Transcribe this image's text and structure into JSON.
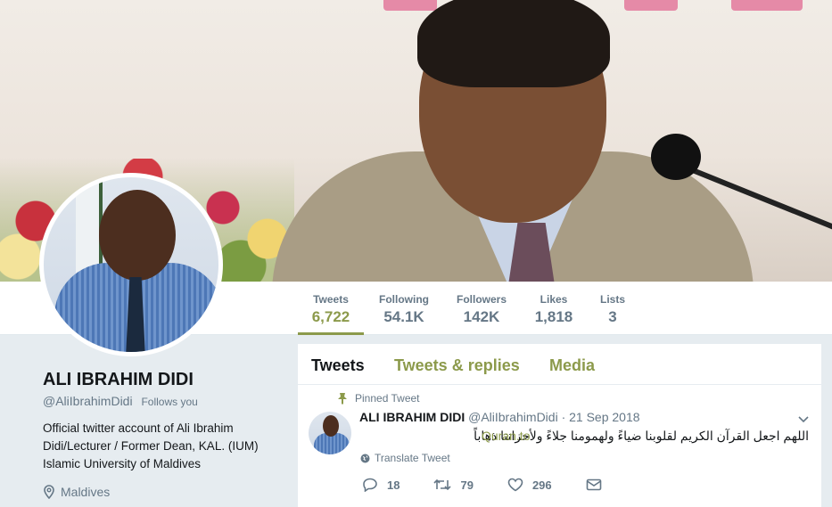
{
  "profile": {
    "name": "ALI IBRAHIM DIDI",
    "handle": "@AliIbrahimDidi",
    "follows_you": "Follows you",
    "bio": "Official twitter account of Ali Ibrahim Didi/Lecturer / Former Dean, KAL. (IUM) Islamic University of Maldives",
    "location": "Maldives"
  },
  "stats": [
    {
      "label": "Tweets",
      "value": "6,722"
    },
    {
      "label": "Following",
      "value": "54.1K"
    },
    {
      "label": "Followers",
      "value": "142K"
    },
    {
      "label": "Likes",
      "value": "1,818"
    },
    {
      "label": "Lists",
      "value": "3"
    }
  ],
  "tabs": [
    {
      "label": "Tweets"
    },
    {
      "label": "Tweets & replies"
    },
    {
      "label": "Media"
    }
  ],
  "tweet": {
    "pinned_label": "Pinned Tweet",
    "author": "ALI IBRAHIM DIDI",
    "handle": "@AliIbrahimDidi",
    "date": "· 21 Sep 2018",
    "text": "اللهم اجعل القرآن الكريم لقلوبنا ضياءً ولهمومنا جلاءً ولأحزاننا ذهاباً",
    "link": "Quran.to",
    "translate": "Translate Tweet",
    "replies": "18",
    "retweets": "79",
    "likes": "296"
  },
  "colors": {
    "accent": "#8c9a4b",
    "muted": "#657786",
    "background": "#e6ecf0"
  },
  "icons": [
    "location-icon",
    "pin-icon",
    "globe-icon",
    "reply-icon",
    "retweet-icon",
    "like-icon",
    "message-icon",
    "chevron-down-icon"
  ]
}
